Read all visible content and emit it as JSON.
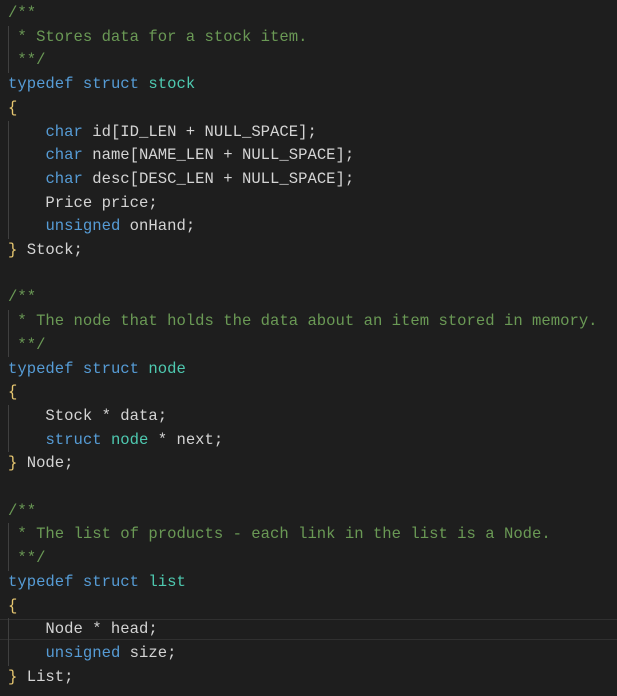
{
  "editor": {
    "current_line": 26,
    "colors": {
      "background": "#1e1e1e",
      "comment": "#6a9955",
      "keyword": "#569cd6",
      "type": "#4ec9b0",
      "text": "#d4d4d4",
      "brace": "#e8c871"
    },
    "lines": [
      [
        [
          "/**",
          "comment"
        ]
      ],
      [
        [
          " * Stores data for a stock item.",
          "comment"
        ]
      ],
      [
        [
          " **/",
          "comment"
        ]
      ],
      [
        [
          "typedef",
          "kw"
        ],
        [
          " ",
          "plain"
        ],
        [
          "struct",
          "kw"
        ],
        [
          " ",
          "plain"
        ],
        [
          "stock",
          "type"
        ]
      ],
      [
        [
          "{",
          "brace"
        ]
      ],
      [
        [
          "    ",
          "plain"
        ],
        [
          "char",
          "kw"
        ],
        [
          " id[ID_LEN + NULL_SPACE];",
          "plain"
        ]
      ],
      [
        [
          "    ",
          "plain"
        ],
        [
          "char",
          "kw"
        ],
        [
          " name[NAME_LEN + NULL_SPACE];",
          "plain"
        ]
      ],
      [
        [
          "    ",
          "plain"
        ],
        [
          "char",
          "kw"
        ],
        [
          " desc[DESC_LEN + NULL_SPACE];",
          "plain"
        ]
      ],
      [
        [
          "    Price price;",
          "plain"
        ]
      ],
      [
        [
          "    ",
          "plain"
        ],
        [
          "unsigned",
          "kw"
        ],
        [
          " onHand;",
          "plain"
        ]
      ],
      [
        [
          "}",
          "brace"
        ],
        [
          " Stock;",
          "plain"
        ]
      ],
      [],
      [
        [
          "/**",
          "comment"
        ]
      ],
      [
        [
          " * The node that holds the data about an item stored in memory.",
          "comment"
        ]
      ],
      [
        [
          " **/",
          "comment"
        ]
      ],
      [
        [
          "typedef",
          "kw"
        ],
        [
          " ",
          "plain"
        ],
        [
          "struct",
          "kw"
        ],
        [
          " ",
          "plain"
        ],
        [
          "node",
          "type"
        ]
      ],
      [
        [
          "{",
          "brace"
        ]
      ],
      [
        [
          "    Stock * data;",
          "plain"
        ]
      ],
      [
        [
          "    ",
          "plain"
        ],
        [
          "struct",
          "kw"
        ],
        [
          " ",
          "plain"
        ],
        [
          "node",
          "type"
        ],
        [
          " * next;",
          "plain"
        ]
      ],
      [
        [
          "}",
          "brace"
        ],
        [
          " Node;",
          "plain"
        ]
      ],
      [],
      [
        [
          "/**",
          "comment"
        ]
      ],
      [
        [
          " * The list of products - each link in the list is a Node.",
          "comment"
        ]
      ],
      [
        [
          " **/",
          "comment"
        ]
      ],
      [
        [
          "typedef",
          "kw"
        ],
        [
          " ",
          "plain"
        ],
        [
          "struct",
          "kw"
        ],
        [
          " ",
          "plain"
        ],
        [
          "list",
          "type"
        ]
      ],
      [
        [
          "{",
          "brace"
        ]
      ],
      [
        [
          "    Node * head;",
          "plain"
        ]
      ],
      [
        [
          "    ",
          "plain"
        ],
        [
          "unsigned",
          "kw"
        ],
        [
          " size;",
          "plain"
        ]
      ],
      [
        [
          "}",
          "brace"
        ],
        [
          " List;",
          "plain"
        ]
      ]
    ]
  }
}
